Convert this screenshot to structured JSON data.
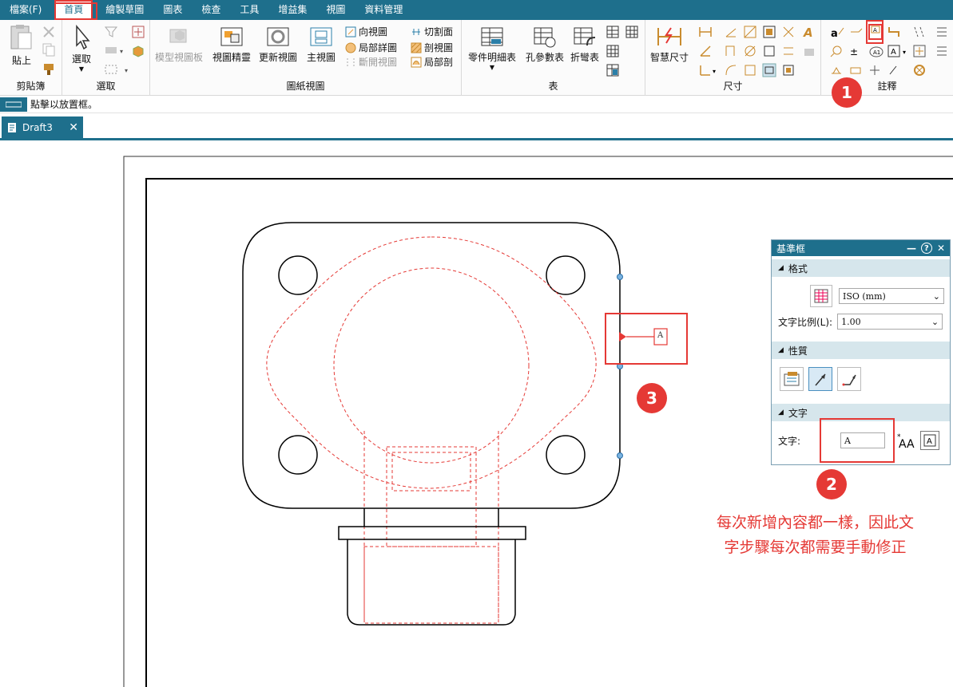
{
  "menu": [
    "檔案(F)",
    "首頁",
    "繪製草圖",
    "圖表",
    "檢查",
    "工具",
    "增益集",
    "視圖",
    "資料管理"
  ],
  "ribbon": {
    "clipboard": {
      "paste": "貼上",
      "group": "剪貼簿"
    },
    "select": {
      "select": "選取",
      "group": "選取"
    },
    "drawing_views": {
      "model_view_palette": "模型視圖板",
      "view_wizard": "視圖精靈",
      "update_views": "更新視圖",
      "principal_view": "主視圖",
      "auxiliary_view": "向視圖",
      "detail_view": "局部詳圖",
      "broken_view": "斷開視圖",
      "cutting_plane": "切割面",
      "section_view": "剖視圖",
      "broken_out_section": "局部剖",
      "group": "圖紙視圖"
    },
    "tables": {
      "parts_list": "零件明細表",
      "hole_table": "孔參數表",
      "bend_table": "折彎表",
      "group": "表"
    },
    "dimension": {
      "smart_dimension": "智慧尺寸",
      "group": "尺寸"
    },
    "annotation": {
      "group": "註釋"
    }
  },
  "command_prompt": "點擊以放置框。",
  "doc_tab": {
    "name": "Draft3"
  },
  "datum_frame_text": "A",
  "panel": {
    "title": "基準框",
    "format_section": "格式",
    "style_value": "ISO (mm)",
    "text_scale_label": "文字比例(L):",
    "text_scale_value": "1.00",
    "properties_section": "性質",
    "text_section": "文字",
    "text_label": "文字:",
    "text_value": "A"
  },
  "callouts": {
    "one": "1",
    "two": "2",
    "three": "3"
  },
  "note_lines": [
    "每次新增內容都一樣，因此文",
    "字步驟每次都需要手動修正"
  ],
  "colors": {
    "accent": "#1e6f8c",
    "highlight": "#e53935",
    "hidden_line": "#e53935"
  }
}
